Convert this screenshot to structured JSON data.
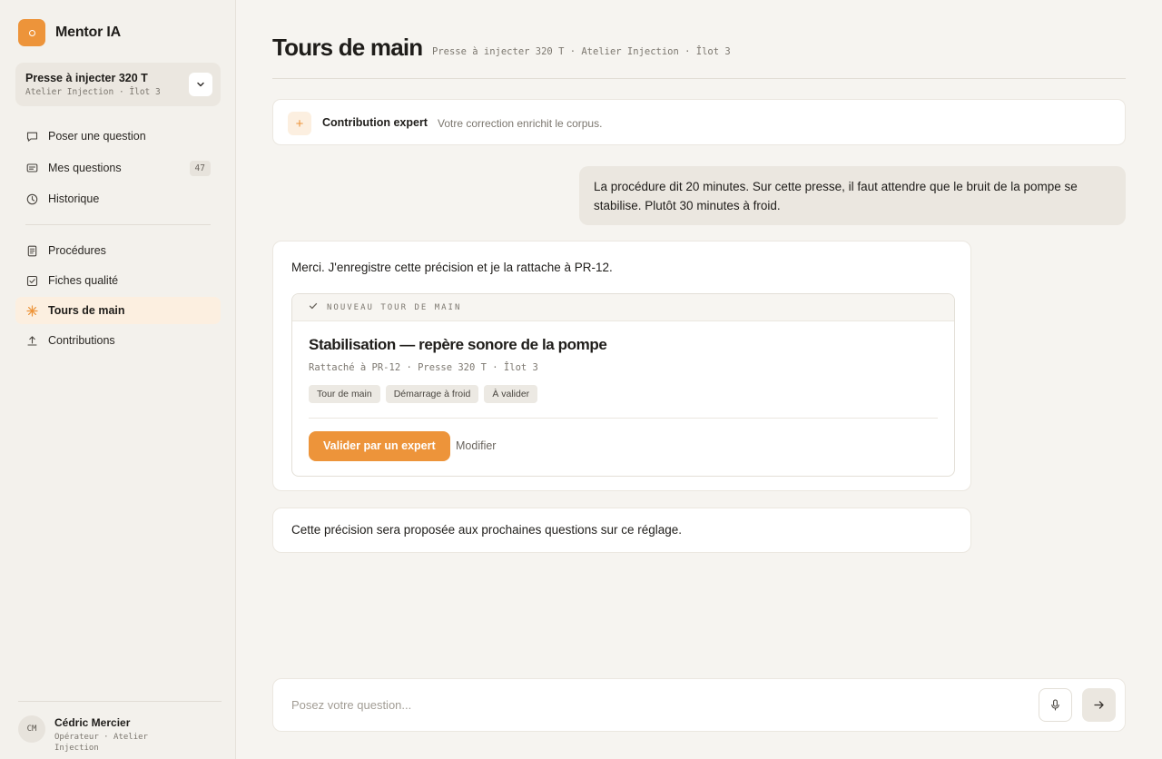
{
  "app": {
    "name": "Mentor IA"
  },
  "machine": {
    "title": "Presse à injecter 320 T",
    "subtitle": "Atelier Injection · Îlot 3"
  },
  "nav": {
    "primary": [
      {
        "label": "Poser une question",
        "icon": "chat-icon"
      },
      {
        "label": "Mes questions",
        "icon": "message-list-icon",
        "badge": "47"
      },
      {
        "label": "Historique",
        "icon": "clock-icon"
      }
    ],
    "secondary": [
      {
        "label": "Procédures",
        "icon": "document-icon"
      },
      {
        "label": "Fiches qualité",
        "icon": "checkbox-icon"
      },
      {
        "label": "Tours de main",
        "icon": "sparkle-icon",
        "active": true
      },
      {
        "label": "Contributions",
        "icon": "upload-icon"
      }
    ]
  },
  "user": {
    "initials": "CM",
    "name": "Cédric Mercier",
    "role": "Opérateur · Atelier Injection"
  },
  "header": {
    "title": "Tours de main",
    "subtitle": "Presse à injecter 320 T · Atelier Injection · Îlot 3"
  },
  "contribution": {
    "title": "Contribution expert",
    "subtitle": "Votre correction enrichit le corpus."
  },
  "conversation": {
    "user_message": "La procédure dit 20 minutes. Sur cette presse, il faut attendre que le bruit de la pompe se stabilise. Plutôt 30 minutes à froid.",
    "ai_message": "Merci. J'enregistre cette précision et je la rattache à PR-12.",
    "ai_followup": "Cette précision sera proposée aux prochaines questions sur ce réglage."
  },
  "tip_card": {
    "kicker": "NOUVEAU TOUR DE MAIN",
    "title": "Stabilisation — repère sonore de la pompe",
    "meta": "Rattaché à PR-12 · Presse 320 T · Îlot 3",
    "tags": [
      "Tour de main",
      "Démarrage à froid",
      "À valider"
    ],
    "validate_label": "Valider par un expert",
    "modify_label": "Modifier"
  },
  "composer": {
    "placeholder": "Posez votre question..."
  },
  "colors": {
    "accent": "#ed943a",
    "accent_soft": "#fcefe0",
    "background": "#f6f4f0"
  }
}
